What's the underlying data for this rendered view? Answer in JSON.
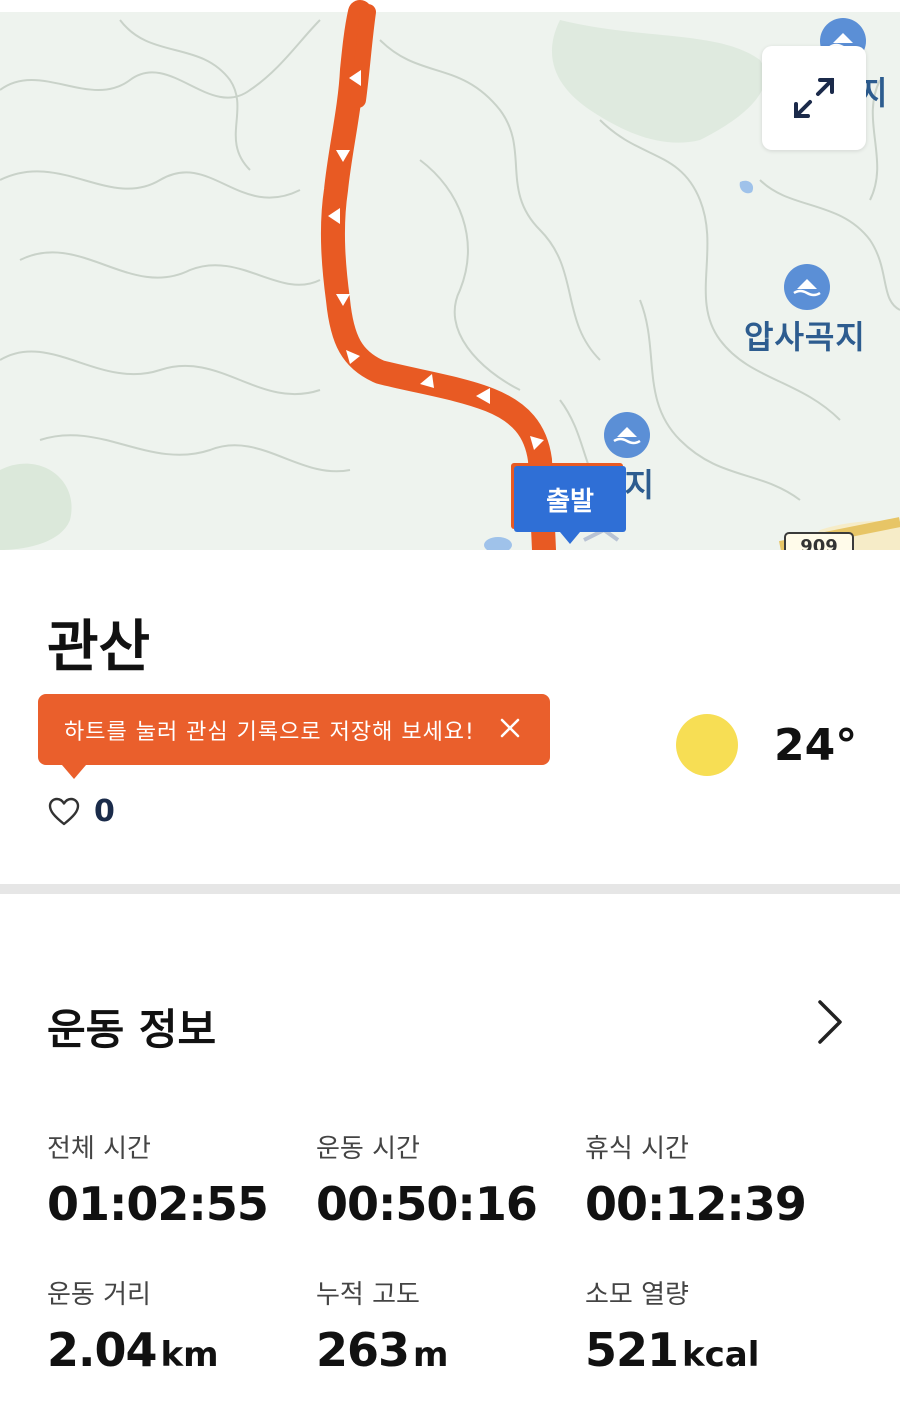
{
  "map": {
    "labels": [
      "지",
      "압사곡지",
      "관지"
    ],
    "start_marker": "출발",
    "road_number": "909",
    "route_color": "#e85a23",
    "marker_color": "#2f6fd6"
  },
  "place": {
    "title": "관산"
  },
  "tooltip": {
    "text": "하트를 눌러 관심 기록으로 저장해 보세요!"
  },
  "like": {
    "count": "0"
  },
  "weather": {
    "temperature": "24°",
    "icon": "sun-icon"
  },
  "exercise": {
    "title": "운동 정보",
    "stats": [
      {
        "label": "전체 시간",
        "value": "01:02:55",
        "unit": ""
      },
      {
        "label": "운동 시간",
        "value": "00:50:16",
        "unit": ""
      },
      {
        "label": "휴식 시간",
        "value": "00:12:39",
        "unit": ""
      },
      {
        "label": "운동 거리",
        "value": "2.04",
        "unit": "km"
      },
      {
        "label": "누적 고도",
        "value": "263",
        "unit": "m"
      },
      {
        "label": "소모 열량",
        "value": "521",
        "unit": "kcal"
      }
    ]
  }
}
